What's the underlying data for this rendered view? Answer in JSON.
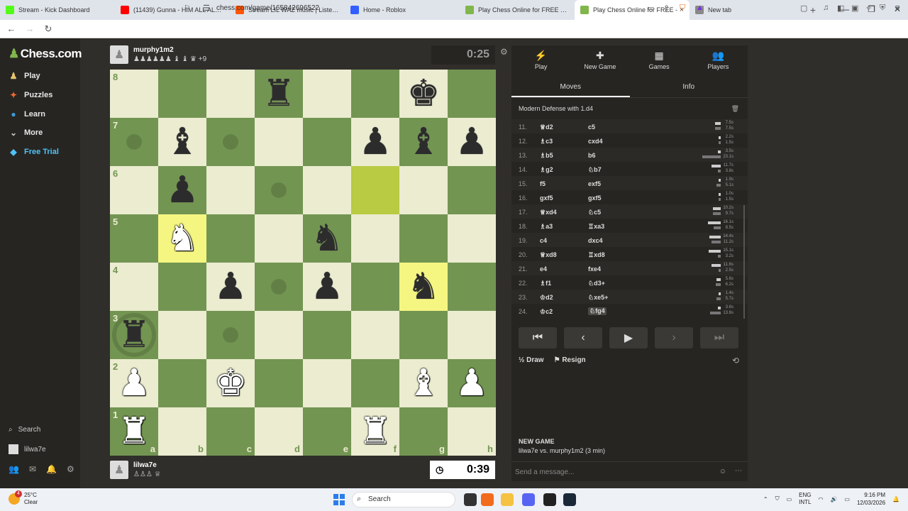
{
  "browser": {
    "tabs": [
      {
        "title": "Stream - Kick Dashboard",
        "color": "#53fc18"
      },
      {
        "title": "(11439) Gunna - HIM ALL ALONG [C",
        "color": "#ff0000"
      },
      {
        "title": "Stream LIL WAZ music | Listen to so",
        "color": "#ff5500"
      },
      {
        "title": "Home - Roblox",
        "color": "#335fff"
      },
      {
        "title": "Play Chess Online for FREE - 2 Pl",
        "color": "#81b64c"
      },
      {
        "title": "Play Chess Online for FREE -",
        "color": "#81b64c"
      },
      {
        "title": "New tab",
        "color": "#888888"
      }
    ],
    "url": "chess.com/game/165842696522"
  },
  "sidebar": {
    "logo": "Chess.com",
    "items": [
      {
        "label": "Play",
        "icon": "♟",
        "color": "#e8c26e"
      },
      {
        "label": "Puzzles",
        "icon": "✦",
        "color": "#f06a2e"
      },
      {
        "label": "Learn",
        "icon": "●",
        "color": "#3a9bd9"
      },
      {
        "label": "More",
        "icon": "⌄",
        "color": "#cccccc"
      },
      {
        "label": "Free Trial",
        "icon": "◆",
        "color": "#4fc3f7"
      }
    ],
    "search": "Search",
    "user": "lilwa7e"
  },
  "top_player": {
    "name": "murphy1m2",
    "captured": "♟♟♟♟♟♟ ♝ ♝ ♛ +9",
    "clock": "0:25"
  },
  "bottom_player": {
    "name": "lilwa7e",
    "captured": "♙♙♙ ♕",
    "clock": "0:39"
  },
  "board": {
    "light": "#ebecd0",
    "dark": "#739552",
    "ranks": [
      [
        "",
        "",
        "",
        "r",
        "",
        "",
        "k",
        ""
      ],
      [
        "",
        "b",
        "",
        "",
        "",
        "p",
        "b",
        "p"
      ],
      [
        "",
        "p",
        "",
        "",
        "",
        "",
        "",
        ""
      ],
      [
        "",
        "N",
        "",
        "",
        "n",
        "",
        "",
        ""
      ],
      [
        "",
        "",
        "p",
        "",
        "p",
        "",
        "n",
        ""
      ],
      [
        "r",
        "",
        "",
        "",
        "",
        "",
        "",
        ""
      ],
      [
        "P",
        "",
        "K",
        "",
        "",
        "",
        "B",
        "P"
      ],
      [
        "R",
        "",
        "",
        "",
        "",
        "R",
        "",
        ""
      ]
    ],
    "rank_labels": [
      "8",
      "7",
      "6",
      "5",
      "4",
      "3",
      "2",
      "1"
    ],
    "file_labels": [
      "a",
      "b",
      "c",
      "d",
      "e",
      "f",
      "g",
      "h"
    ]
  },
  "panel": {
    "tabs": [
      {
        "label": "Play",
        "icon": "⚡"
      },
      {
        "label": "New Game",
        "icon": "✚"
      },
      {
        "label": "Games",
        "icon": "▦"
      },
      {
        "label": "Players",
        "icon": "👥"
      }
    ],
    "subtabs": [
      "Moves",
      "Info"
    ],
    "opening": "Modern Defense with 1.d4",
    "moves": [
      {
        "n": "11.",
        "w": "♕d2",
        "b": "c5",
        "tw": "7.5s",
        "tb": "7.5s"
      },
      {
        "n": "12.",
        "w": "♗c3",
        "b": "cxd4",
        "tw": "2.2s",
        "tb": "1.5s"
      },
      {
        "n": "13.",
        "w": "♗b5",
        "b": "b6",
        "tw": "3.5s",
        "tb": "23.1s"
      },
      {
        "n": "14.",
        "w": "♗g2",
        "b": "♘b7",
        "tw": "11.7s",
        "tb": "3.8s"
      },
      {
        "n": "15.",
        "w": "f5",
        "b": "exf5",
        "tw": "1.9s",
        "tb": "5.1s"
      },
      {
        "n": "16.",
        "w": "gxf5",
        "b": "gxf5",
        "tw": "1.0s",
        "tb": "1.5s"
      },
      {
        "n": "17.",
        "w": "♕xd4",
        "b": "♘c5",
        "tw": "10.2s",
        "tb": "9.7s"
      },
      {
        "n": "18.",
        "w": "♗a3",
        "b": "♖xa3",
        "tw": "16.1s",
        "tb": "8.5s"
      },
      {
        "n": "19.",
        "w": "c4",
        "b": "dxc4",
        "tw": "14.4s",
        "tb": "11.2s"
      },
      {
        "n": "20.",
        "w": "♕xd8",
        "b": "♖xd8",
        "tw": "15.1s",
        "tb": "3.2s"
      },
      {
        "n": "21.",
        "w": "e4",
        "b": "fxe4",
        "tw": "11.6s",
        "tb": "2.5s"
      },
      {
        "n": "22.",
        "w": "♗f1",
        "b": "♘d3+",
        "tw": "5.6s",
        "tb": "6.2s"
      },
      {
        "n": "23.",
        "w": "♔d2",
        "b": "♘xe5+",
        "tw": "1.4s",
        "tb": "5.7s"
      },
      {
        "n": "24.",
        "w": "♔c2",
        "b": "♘fg4",
        "tw": "3.6s",
        "tb": "13.6s"
      }
    ],
    "draw": "Draw",
    "resign": "Resign",
    "new_game_title": "NEW GAME",
    "new_game_sub": "lilwa7e vs. murphy1m2 (3 min)",
    "chat_placeholder": "Send a message..."
  },
  "taskbar": {
    "temp": "25°C",
    "weather": "Clear",
    "badge": "4",
    "search": "Search",
    "lang1": "ENG",
    "lang2": "INTL",
    "time": "9:16 PM",
    "date": "12/03/2026"
  }
}
